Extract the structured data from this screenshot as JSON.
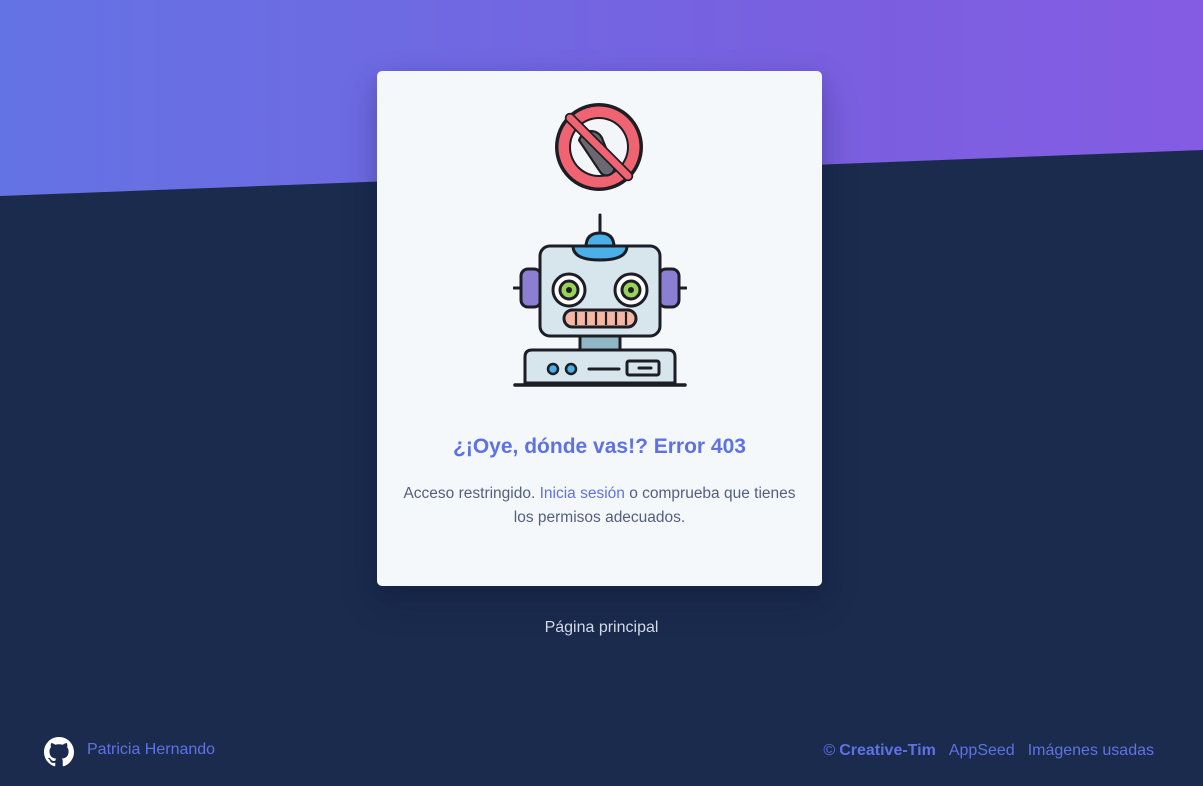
{
  "error": {
    "title": "¿¡Oye, dónde vas!? Error 403",
    "desc_before": "Acceso restringido.",
    "login_link": "Inicia sesión",
    "desc_after": "o comprueba que tienes los permisos adecuados."
  },
  "home_link": "Página principal",
  "footer": {
    "author": "Patricia Hernando",
    "copyright_symbol": "©",
    "brand": "Creative-Tim",
    "appseed": "AppSeed",
    "images": "Imágenes usadas"
  },
  "colors": {
    "accent": "#5e72e4",
    "background": "#1a2b4e",
    "card": "#f5f8fb",
    "gradient_start": "#6473e4",
    "gradient_end": "#845ce3"
  },
  "icons": [
    "prohibited-sign-icon",
    "robot-illustration",
    "github-icon"
  ]
}
